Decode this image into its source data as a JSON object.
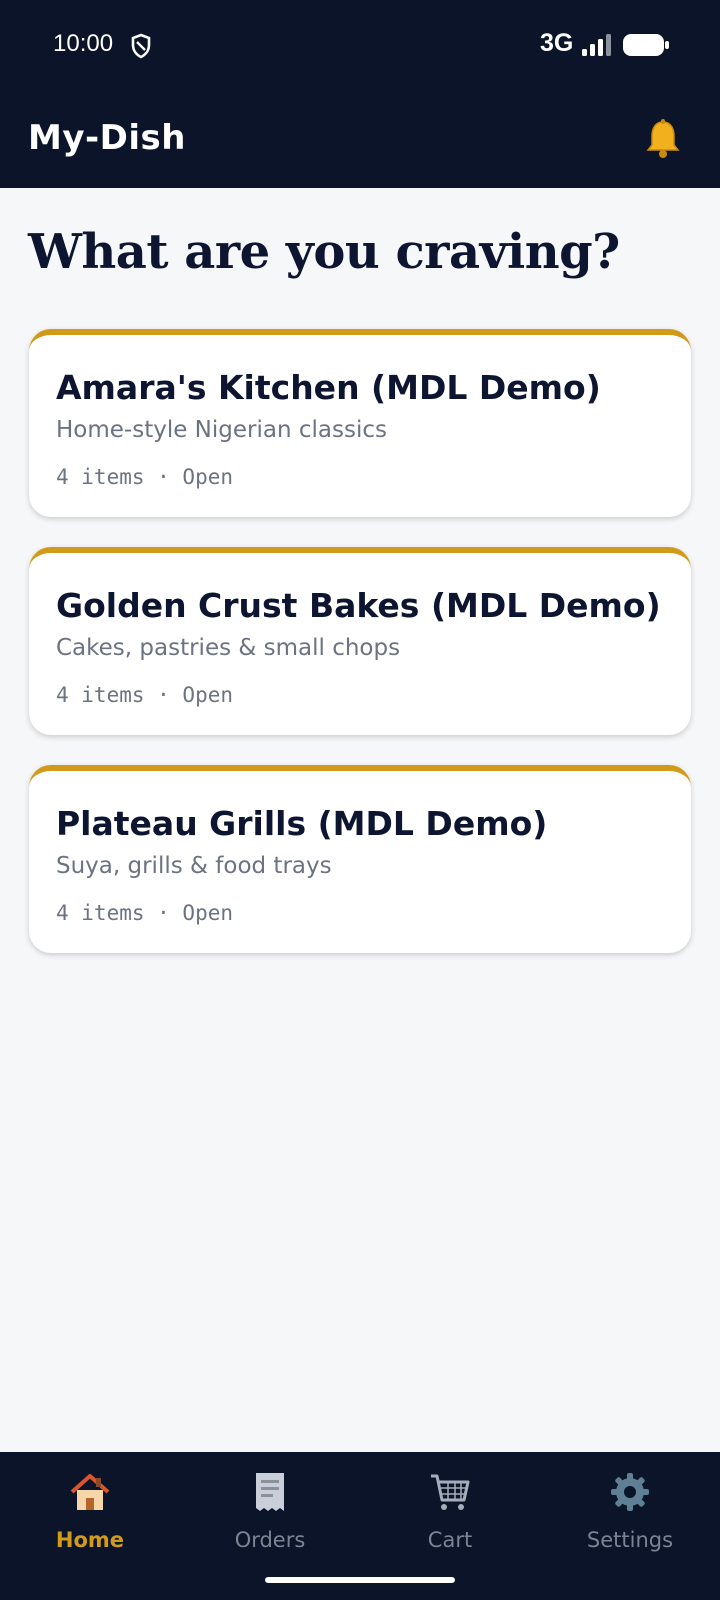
{
  "status_bar": {
    "time": "10:00",
    "network": "3G",
    "icons": [
      "shield-icon",
      "signal-icon",
      "battery-icon"
    ]
  },
  "app_bar": {
    "title": "My-Dish",
    "notification_icon": "bell-icon"
  },
  "main": {
    "heading": "What are you craving?",
    "restaurants": [
      {
        "name": "Amara's Kitchen (MDL Demo)",
        "description": "Home-style Nigerian classics",
        "meta": "4 items · Open"
      },
      {
        "name": "Golden Crust Bakes (MDL Demo)",
        "description": "Cakes, pastries & small chops",
        "meta": "4 items · Open"
      },
      {
        "name": "Plateau Grills (MDL Demo)",
        "description": "Suya, grills & food trays",
        "meta": "4 items · Open"
      }
    ]
  },
  "bottom_nav": {
    "items": [
      {
        "label": "Home",
        "icon": "house-icon",
        "active": true
      },
      {
        "label": "Orders",
        "icon": "receipt-icon",
        "active": false
      },
      {
        "label": "Cart",
        "icon": "cart-icon",
        "active": false
      },
      {
        "label": "Settings",
        "icon": "gear-icon",
        "active": false
      }
    ]
  },
  "colors": {
    "bar_background": "#0b1428",
    "accent": "#d29a1a",
    "page_background": "#f6f7f9",
    "muted_text": "#6b7382"
  }
}
